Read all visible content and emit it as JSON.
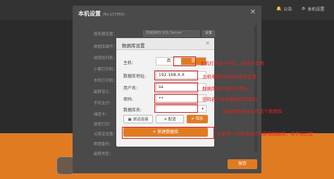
{
  "topbar": {
    "notice_label": "公告",
    "settings_label": "本机设置"
  },
  "main_dialog": {
    "title": "本机设置",
    "title_suffix": "(No.157055)",
    "rows": [
      "服务器设置：",
      "数据库编号：",
      "收银员列表：",
      "小票打印机：",
      "本机打印机：",
      "副屏显示：",
      "手机支付：",
      "储值卡：",
      "厨房打印：",
      "点菜宝设置：",
      "数据备份：",
      "副屏类型："
    ],
    "server_type_value": "局域网BS SQL Server",
    "server_btn": "设置",
    "save_label": "保存"
  },
  "db_dialog": {
    "title": "数据库设置",
    "host_label": "主机:",
    "host_options": [
      "否",
      "是"
    ],
    "host_selected": "是",
    "address_label": "数据库地址:",
    "address_value": "192.168.X.X",
    "user_label": "用户名:",
    "user_value": "sa",
    "password_label": "密码:",
    "password_value": "••",
    "dbname_label": "数据库名:",
    "test_label": "测试连接",
    "cancel_label": "取消",
    "save_label": "保存",
    "new_db_label": "+ 新建数据库"
  },
  "annotations": {
    "note1": "主机打开这个开关，否则不会用",
    "note2": "主机电脑的IP地址填写这里",
    "note3": "数据库用户名默认是sa",
    "note4": "密码自己本机数据库的密码",
    "note5": "选择你要连接主机这个数据库",
    "note6": "主机第一次新增请点击新增数据库，名字自己定"
  }
}
